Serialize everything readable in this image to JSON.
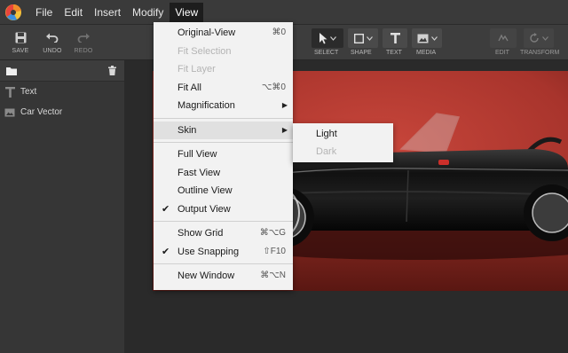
{
  "menubar": {
    "items": [
      {
        "label": "File"
      },
      {
        "label": "Edit"
      },
      {
        "label": "Insert"
      },
      {
        "label": "Modify"
      },
      {
        "label": "View"
      }
    ]
  },
  "toolbar": {
    "save_label": "SAVE",
    "undo_label": "UNDO",
    "redo_label": "REDO",
    "select_label": "SELECT",
    "shape_label": "SHAPE",
    "text_label": "TEXT",
    "media_label": "MEDIA",
    "edit_label": "EDIT",
    "transform_label": "TRANSFORM"
  },
  "layers": [
    {
      "label": "Text",
      "icon": "text-icon"
    },
    {
      "label": "Car Vector",
      "icon": "image-icon"
    }
  ],
  "view_menu": {
    "original_view": {
      "label": "Original-View",
      "shortcut": "⌘0"
    },
    "fit_selection": {
      "label": "Fit Selection"
    },
    "fit_layer": {
      "label": "Fit Layer"
    },
    "fit_all": {
      "label": "Fit All",
      "shortcut": "⌥⌘0"
    },
    "magnification": {
      "label": "Magnification"
    },
    "skin": {
      "label": "Skin"
    },
    "full_view": {
      "label": "Full View"
    },
    "fast_view": {
      "label": "Fast View"
    },
    "outline_view": {
      "label": "Outline View"
    },
    "output_view": {
      "label": "Output View"
    },
    "show_grid": {
      "label": "Show Grid",
      "shortcut": "⌘⌥G"
    },
    "use_snapping": {
      "label": "Use Snapping",
      "shortcut": "⇧F10"
    },
    "new_window": {
      "label": "New Window",
      "shortcut": "⌘⌥N"
    }
  },
  "skin_menu": {
    "light": "Light",
    "dark": "Dark"
  },
  "colors": {
    "accent": "#1d1d1d",
    "artwork_background": "#b8372f",
    "menu_background": "#f2f2f2"
  }
}
